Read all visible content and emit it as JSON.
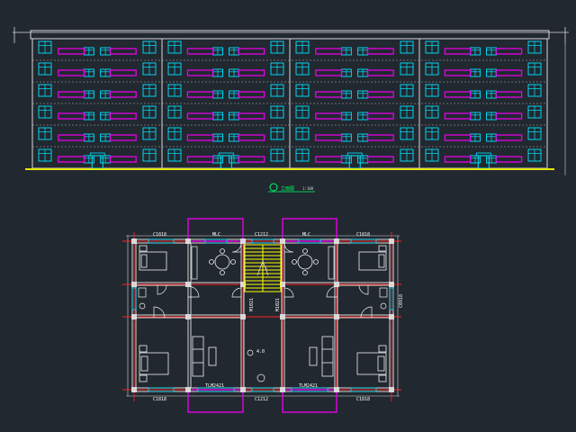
{
  "colors": {
    "background": "#212830",
    "outline": "#d8d8d8",
    "window": "#00e5ff",
    "balcony": "#e600e6",
    "ground": "#e6e600",
    "axis": "#ff2020",
    "stair": "#ffff00",
    "furniture": "#f2f2f2",
    "door": "#00ff66",
    "label": "#ffffff"
  },
  "elevation": {
    "floors": 6,
    "units": 4,
    "title": "立面图",
    "scale": "1:100"
  },
  "plan": {
    "window_labels": {
      "top_left": "C1818",
      "top_right": "C1818",
      "bottom_left": "C1818",
      "bottom_right": "C1818",
      "top_center": "C1212",
      "bottom_center": "C1212",
      "balcony_left": "MLC",
      "balcony_right": "MLC",
      "living_left": "TLM2421",
      "living_right": "TLM2421",
      "side_right": "C0918"
    },
    "door_labels": {
      "left": "M1021",
      "right": "M1021"
    },
    "stair_label": "上",
    "hall_label": "4.0"
  }
}
